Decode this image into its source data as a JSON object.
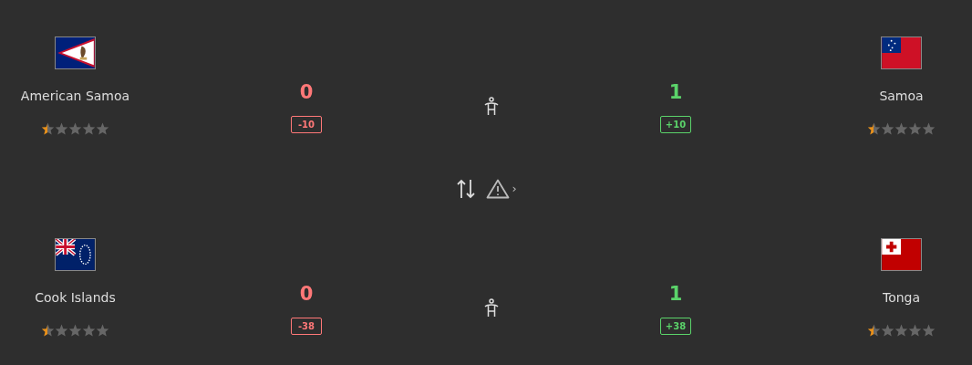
{
  "matches": [
    {
      "home": {
        "name": "American Samoa",
        "stars": 0.5,
        "score": "0",
        "delta": "-10",
        "won": false
      },
      "away": {
        "name": "Samoa",
        "stars": 0.5,
        "score": "1",
        "delta": "+10",
        "won": true
      }
    },
    {
      "home": {
        "name": "Cook Islands",
        "stars": 0.5,
        "score": "0",
        "delta": "-38",
        "won": false
      },
      "away": {
        "name": "Tonga",
        "stars": 0.5,
        "score": "1",
        "delta": "+38",
        "won": true
      }
    }
  ],
  "separator": {
    "chevron": "›"
  }
}
